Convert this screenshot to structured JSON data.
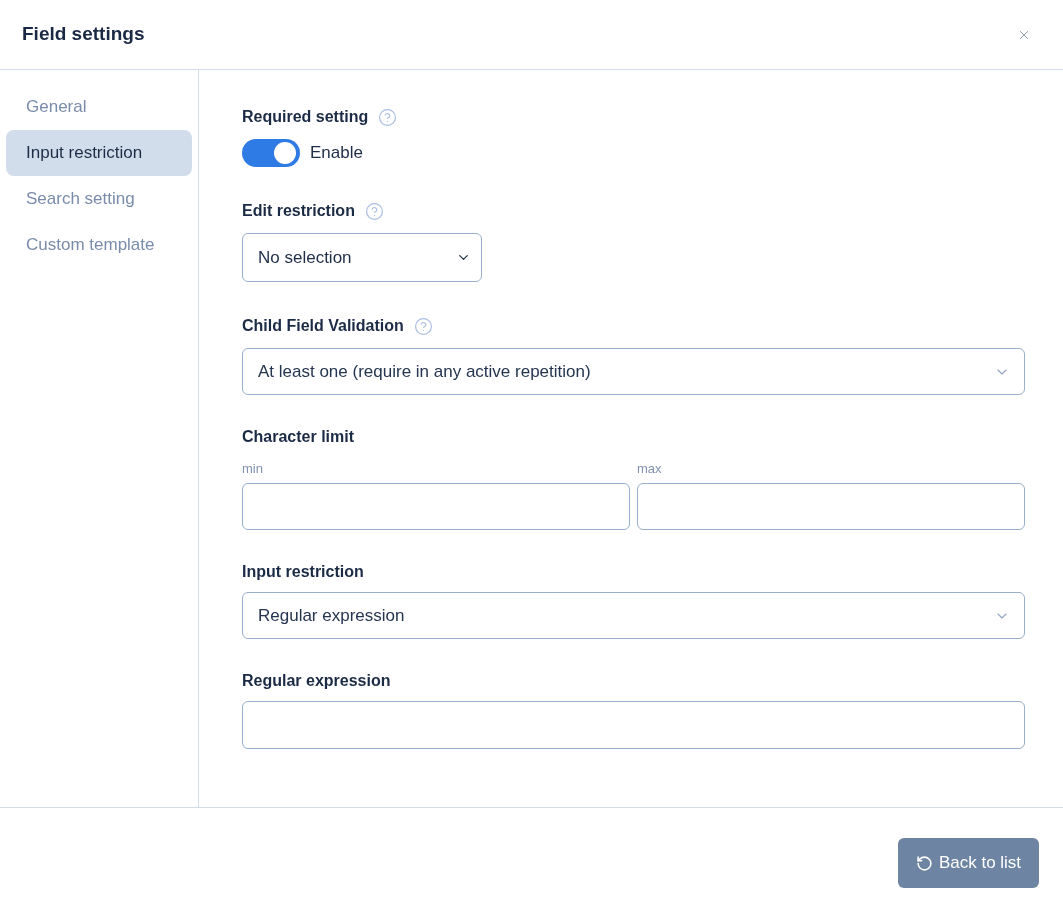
{
  "dialog": {
    "title": "Field settings"
  },
  "sidebar": {
    "items": [
      {
        "label": "General",
        "selected": false
      },
      {
        "label": "Input restriction",
        "selected": true
      },
      {
        "label": "Search setting",
        "selected": false
      },
      {
        "label": "Custom template",
        "selected": false
      }
    ]
  },
  "sections": [
    {
      "kind": "toggle",
      "label": "Required setting",
      "help": true,
      "on": true,
      "toggle_label": "Enable"
    },
    {
      "kind": "native_select",
      "label": "Edit restriction",
      "help": true,
      "value": "No selection"
    },
    {
      "kind": "select",
      "label": "Child Field Validation",
      "help": true,
      "value": "At least one (require in any active repetition)"
    },
    {
      "kind": "range",
      "label": "Character limit",
      "fields": [
        {
          "label": "min"
        },
        {
          "label": "max"
        }
      ]
    },
    {
      "kind": "select",
      "label": "Input restriction",
      "value": "Regular expression"
    },
    {
      "kind": "input",
      "label": "Regular expression"
    }
  ],
  "footer": {
    "button": "Back to list"
  }
}
